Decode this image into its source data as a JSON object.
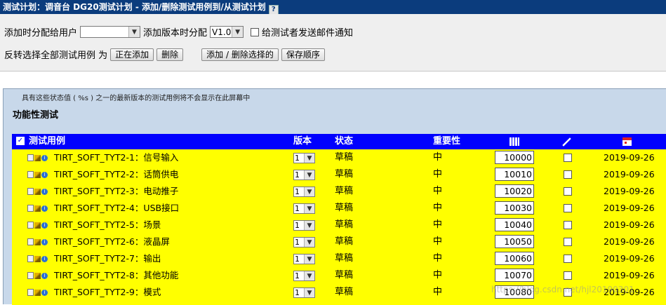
{
  "title": "测试计划：调音台 DG20测试计划 - 添加/删除测试用例到/从测试计划",
  "help_icon": "?",
  "toolbar": {
    "assign_label": "添加时分配给用户",
    "assign_value": "",
    "version_label": "添加版本时分配",
    "version_value": "V1.0",
    "email_label": "给测试者发送邮件通知",
    "invert_label": "反转选择全部测试用例 为",
    "btn_adding": "正在添加",
    "btn_delete": "删除",
    "btn_add_remove": "添加 / 删除选择的",
    "btn_save_order": "保存顺序"
  },
  "notice": "具有这些状态值 ( %s ) 之一的最新版本的测试用例将不会显示在此屏幕中",
  "section_title": "功能性测试",
  "table": {
    "headers": {
      "case": "测试用例",
      "version": "版本",
      "status": "状态",
      "importance": "重要性"
    },
    "header_icons": [
      "order-icon",
      "assign-icon",
      "calendar-icon"
    ],
    "rows": [
      {
        "name": "TIRT_SOFT_TYT2-1：信号输入",
        "version": "1",
        "status": "草稿",
        "importance": "中",
        "order": "10000",
        "date": "2019-09-26"
      },
      {
        "name": "TIRT_SOFT_TYT2-2：话筒供电",
        "version": "1",
        "status": "草稿",
        "importance": "中",
        "order": "10010",
        "date": "2019-09-26"
      },
      {
        "name": "TIRT_SOFT_TYT2-3：电动推子",
        "version": "1",
        "status": "草稿",
        "importance": "中",
        "order": "10020",
        "date": "2019-09-26"
      },
      {
        "name": "TIRT_SOFT_TYT2-4：USB接口",
        "version": "1",
        "status": "草稿",
        "importance": "中",
        "order": "10030",
        "date": "2019-09-26"
      },
      {
        "name": "TIRT_SOFT_TYT2-5：场景",
        "version": "1",
        "status": "草稿",
        "importance": "中",
        "order": "10040",
        "date": "2019-09-26"
      },
      {
        "name": "TIRT_SOFT_TYT2-6：液晶屏",
        "version": "1",
        "status": "草稿",
        "importance": "中",
        "order": "10050",
        "date": "2019-09-26"
      },
      {
        "name": "TIRT_SOFT_TYT2-7：输出",
        "version": "1",
        "status": "草稿",
        "importance": "中",
        "order": "10060",
        "date": "2019-09-26"
      },
      {
        "name": "TIRT_SOFT_TYT2-8：其他功能",
        "version": "1",
        "status": "草稿",
        "importance": "中",
        "order": "10070",
        "date": "2019-09-26"
      },
      {
        "name": "TIRT_SOFT_TYT2-9：模式",
        "version": "1",
        "status": "草稿",
        "importance": "中",
        "order": "10080",
        "date": "2019-09-26"
      }
    ]
  },
  "watermark": "https://blog.csdn.net/hjl20190301",
  "colors": {
    "titlebar": "#0b3c7d",
    "grid_header": "#0000ff",
    "grid_body": "#ffff00",
    "panel": "#c8d8ea"
  }
}
